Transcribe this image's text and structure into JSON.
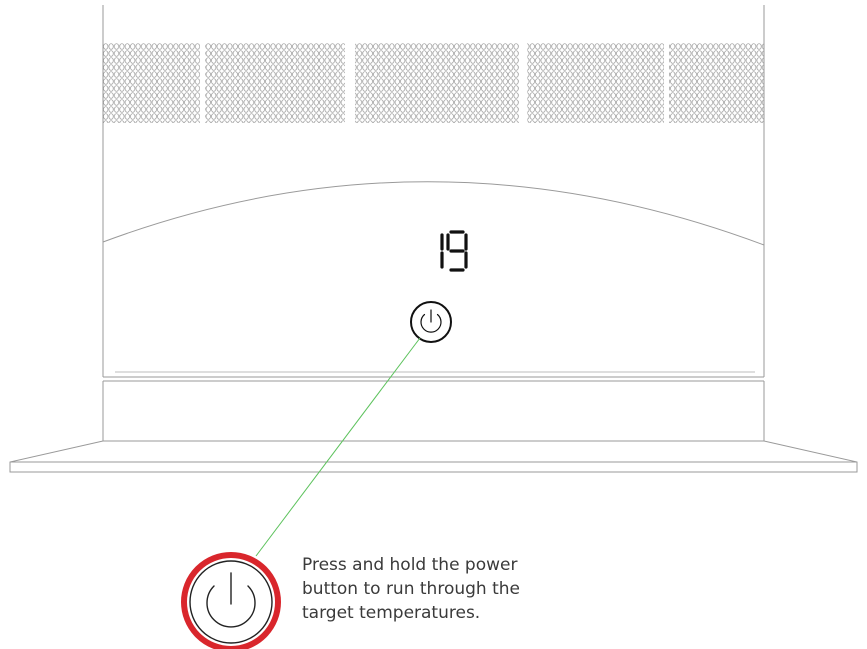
{
  "display": {
    "temperature": "19"
  },
  "callout": {
    "lines": [
      "Press and hold the power",
      "button to run through the",
      "target temperatures."
    ]
  },
  "icons": {
    "power_button": "power-icon",
    "callout_power_button": "power-icon"
  },
  "colors": {
    "outline": "#999999",
    "leader_line": "#5cc25c",
    "highlight_ring": "#d9262c",
    "display_segments": "#111111"
  }
}
